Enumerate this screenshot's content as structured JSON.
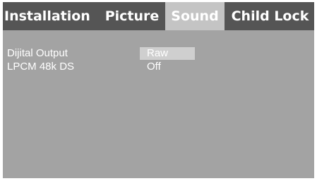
{
  "tabs": [
    {
      "label": "Installation",
      "active": false
    },
    {
      "label": "Picture",
      "active": false
    },
    {
      "label": "Sound",
      "active": true
    },
    {
      "label": "Child Lock",
      "active": false
    }
  ],
  "settings": [
    {
      "label": "Dijital Output",
      "value": "Raw",
      "selected": true
    },
    {
      "label": "LPCM 48k DS",
      "value": "Off",
      "selected": false
    }
  ],
  "colors": {
    "tabbar": "#555555",
    "active_tab": "#c4c4c4",
    "panel": "#a3a3a3",
    "text": "#ffffff",
    "highlight": "#cfcfcf"
  }
}
